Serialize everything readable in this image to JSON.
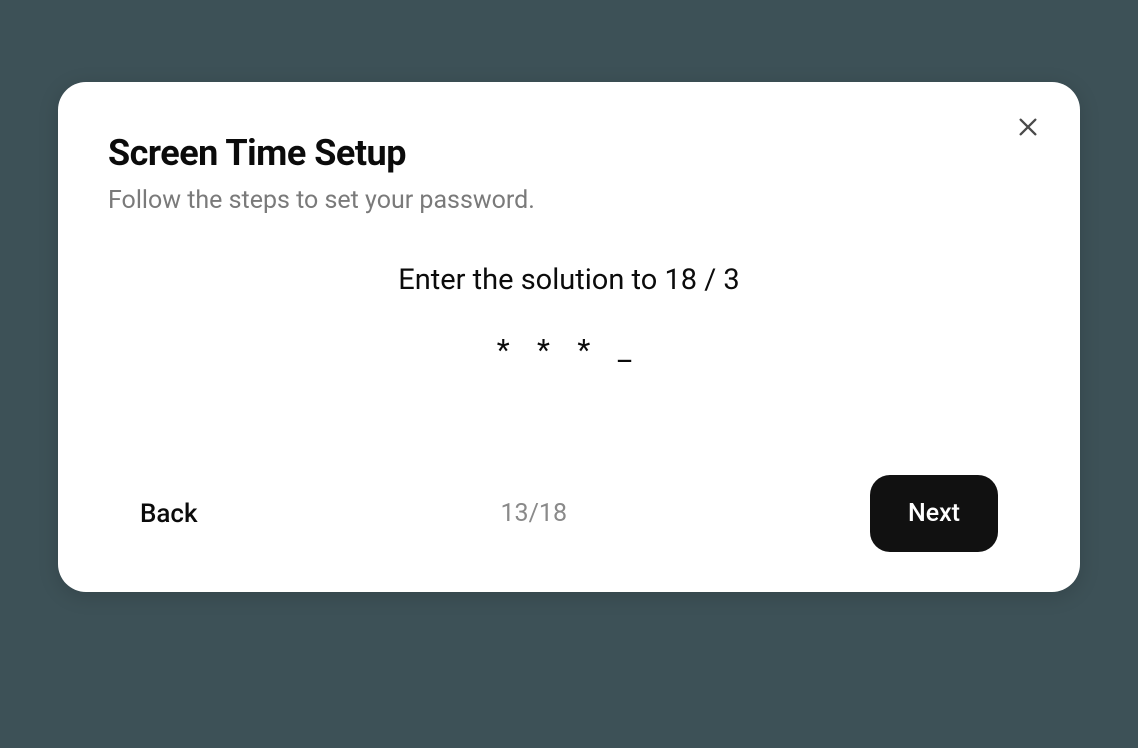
{
  "dialog": {
    "title": "Screen Time Setup",
    "subtitle": "Follow the steps to set your password.",
    "prompt": "Enter the solution to 18 / 3",
    "password_display": "* * * _",
    "step_indicator": "13/18",
    "back_label": "Back",
    "next_label": "Next"
  }
}
